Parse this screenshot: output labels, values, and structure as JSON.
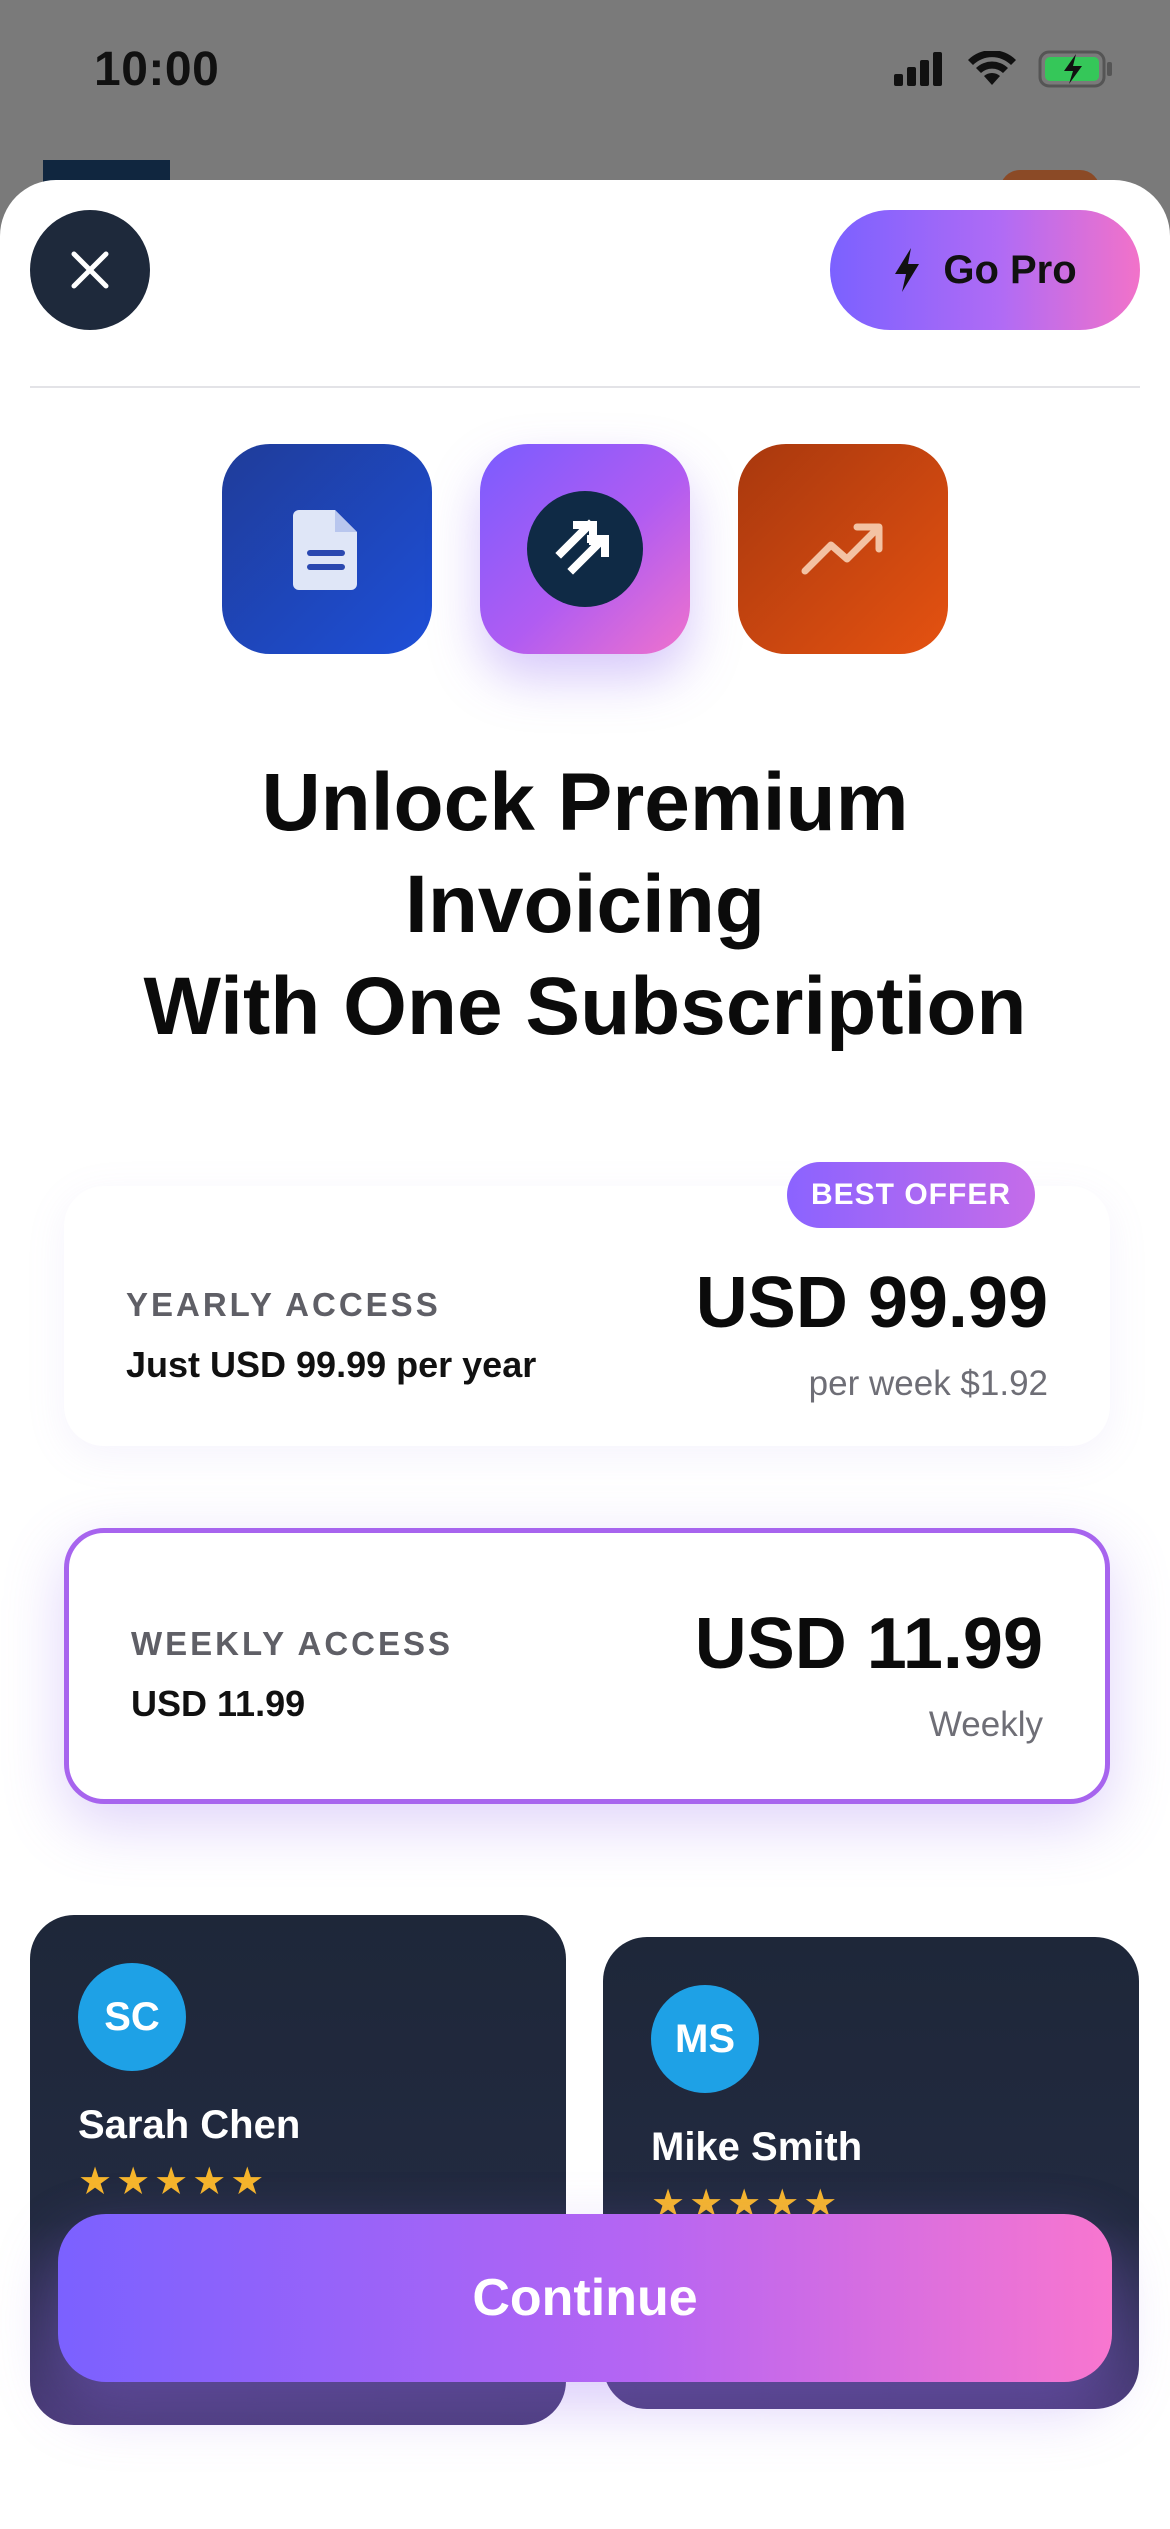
{
  "status_bar": {
    "time": "10:00",
    "icons": [
      "signal-icon",
      "wifi-icon",
      "battery-charging-icon"
    ]
  },
  "header": {
    "close_icon": "close-icon",
    "go_pro_label": "Go Pro",
    "go_pro_icon": "lightning-icon"
  },
  "app_icons": [
    "document-icon",
    "app-logo-icon",
    "trending-up-icon"
  ],
  "headline": {
    "line1": "Unlock Premium",
    "line2": "Invoicing",
    "line3": "With One Subscription"
  },
  "plans": {
    "yearly": {
      "badge": "BEST OFFER",
      "kicker": "YEARLY ACCESS",
      "subtitle": "Just USD 99.99 per year",
      "price": "USD 99.99",
      "note": "per week $1.92"
    },
    "weekly": {
      "kicker": "WEEKLY ACCESS",
      "subtitle": "USD 11.99",
      "price": "USD 11.99",
      "note": "Weekly",
      "selected": true
    }
  },
  "reviews": [
    {
      "initials": "SC",
      "name": "Sarah Chen",
      "stars": "★★★★★",
      "rating": 5
    },
    {
      "initials": "MS",
      "name": "Mike Smith",
      "stars": "★★★★★",
      "rating": 5
    }
  ],
  "continue_label": "Continue",
  "colors": {
    "accent_start": "#7b61ff",
    "accent_end": "#f876cf",
    "selected_border": "#a764ee",
    "dark_card": "#1e2739",
    "avatar_blue": "#1ea1e6",
    "star": "#f6b52b"
  }
}
